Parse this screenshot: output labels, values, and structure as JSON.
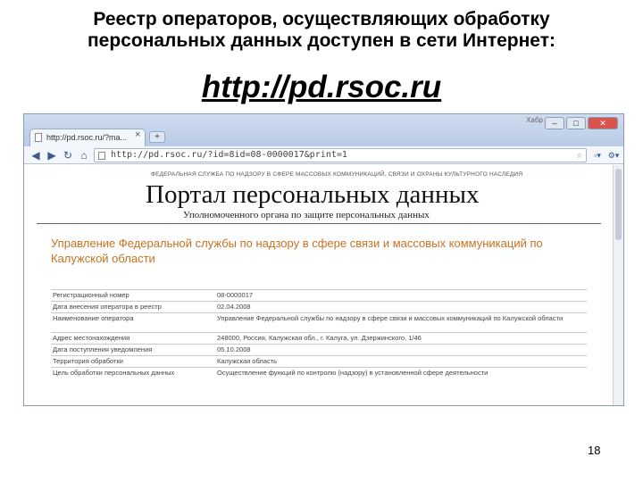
{
  "slide": {
    "title_line1": "Реестр операторов, осуществляющих обработку",
    "title_line2": "персональных данных доступен в сети Интернет:",
    "url": "http://pd.rsoc.ru",
    "page_number": "18"
  },
  "browser": {
    "tab_title": "http://pd.rsoc.ru/?ma...",
    "tab_close": "×",
    "new_tab": "+",
    "top_mark": "Хабр",
    "window_controls": [
      "–",
      "□",
      "✕"
    ],
    "back": "◀",
    "forward": "▶",
    "reload": "↻",
    "home": "⌂",
    "address": "http://pd.rsoc.ru/?id=8id=08-0000017&print=1",
    "star": "☆",
    "page_menu": "▫▾",
    "tools_menu": "⚙▾"
  },
  "page": {
    "agency_line": "ФЕДЕРАЛЬНАЯ СЛУЖБА ПО НАДЗОРУ В СФЕРЕ МАССОВЫХ КОММУНИКАЦИЙ, СВЯЗИ И ОХРАНЫ КУЛЬТУРНОГО НАСЛЕДИЯ",
    "portal_title": "Портал персональных данных",
    "portal_subtitle": "Уполномоченного органа по защите персональных данных",
    "org_title": "Управление Федеральной службы по надзору в сфере связи и массовых коммуникаций по Калужской области",
    "rows": [
      {
        "label": "Регистрационный номер",
        "value": "08-0000017"
      },
      {
        "label": "Дата внесения оператора в реестр",
        "value": "02.04.2008"
      },
      {
        "label": "Наименование оператора",
        "value": "Управление Федеральной службы по надзору в сфере связи и массовых коммуникаций по Калужской области"
      },
      {
        "label": "Адрес местонахождения",
        "value": "248000, Россия, Калужская обл., г. Калуга, ул. Дзержинского, 1/46"
      },
      {
        "label": "Дата поступления уведомления",
        "value": "05.10.2008"
      },
      {
        "label": "Территория обработки",
        "value": "Калужская область"
      },
      {
        "label": "Цель обработки персональных данных",
        "value": "Осуществление функций по контролю (надзору) в установленной сфере деятельности"
      }
    ]
  },
  "colors": {
    "org_title": "#c8711e",
    "chrome_frame": "#b9cbe6",
    "close_button": "#d9534f"
  }
}
